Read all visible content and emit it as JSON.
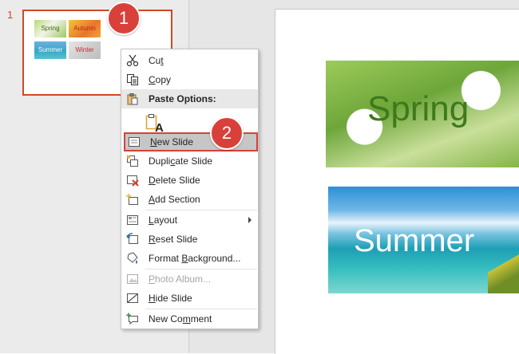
{
  "thumbnail_pane": {
    "slide_number": "1",
    "thumbnails": [
      {
        "label": "Spring"
      },
      {
        "label": "Autumn"
      },
      {
        "label": "Summer"
      },
      {
        "label": "Winter"
      }
    ]
  },
  "slide": {
    "pictures": [
      {
        "label": "Spring"
      },
      {
        "label": "Summer"
      }
    ]
  },
  "callouts": [
    "1",
    "2"
  ],
  "context_menu": {
    "items": [
      {
        "pre": "Cu",
        "u": "t",
        "post": "",
        "icon": "scissors-icon",
        "enabled": true
      },
      {
        "pre": "",
        "u": "C",
        "post": "opy",
        "icon": "copy-icon",
        "enabled": true
      },
      {
        "pre": "Paste Options:",
        "u": "",
        "post": "",
        "icon": "paste-icon",
        "enabled": true
      },
      {
        "pre": "",
        "u": "N",
        "post": "ew Slide",
        "icon": "new-slide-icon",
        "enabled": true
      },
      {
        "pre": "Dupli",
        "u": "c",
        "post": "ate Slide",
        "icon": "duplicate-slide-icon",
        "enabled": true
      },
      {
        "pre": "",
        "u": "D",
        "post": "elete Slide",
        "icon": "delete-slide-icon",
        "enabled": true
      },
      {
        "pre": "",
        "u": "A",
        "post": "dd Section",
        "icon": "add-section-icon",
        "enabled": true
      },
      {
        "pre": "",
        "u": "L",
        "post": "ayout",
        "icon": "layout-icon",
        "enabled": true
      },
      {
        "pre": "",
        "u": "R",
        "post": "eset Slide",
        "icon": "reset-slide-icon",
        "enabled": true
      },
      {
        "pre": "Format ",
        "u": "B",
        "post": "ackground...",
        "icon": "format-background-icon",
        "enabled": true
      },
      {
        "pre": "",
        "u": "P",
        "post": "hoto Album...",
        "icon": "photo-album-icon",
        "enabled": false
      },
      {
        "pre": "",
        "u": "H",
        "post": "ide Slide",
        "icon": "hide-slide-icon",
        "enabled": true
      },
      {
        "pre": "New Co",
        "u": "m",
        "post": "ment",
        "icon": "new-comment-icon",
        "enabled": true
      }
    ],
    "paste_option_glyph": "A"
  },
  "colors": {
    "accent": "#d24726",
    "callout": "#d9403a",
    "highlight": "#c6c6c6"
  }
}
